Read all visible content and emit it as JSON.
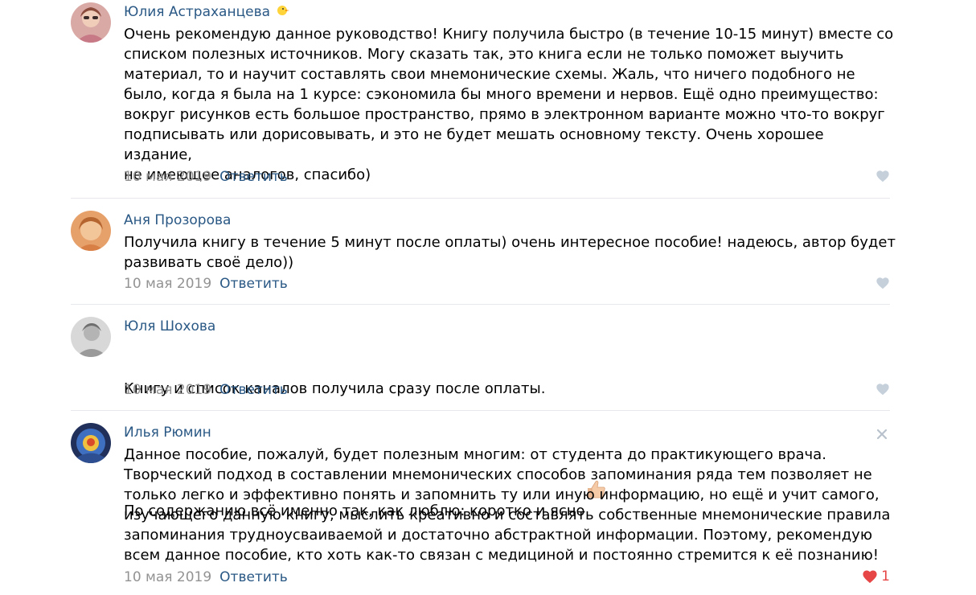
{
  "comments": [
    {
      "author": "Юлия Астраханцева",
      "author_emoji": "🐥",
      "text": "Очень рекомендую данное руководство! Книгу получила быстро (в течение 10-15 минут) вместе со\nсписком полезных источников. Могу сказать так, это книга если не только поможет выучить\nматериал, то и научит составлять свои мнемонические схемы. Жаль, что ничего подобного не\nбыло, когда я была на 1 курсе: сэкономила бы много времени и нервов. Ещё одно преимущество:\nвокруг рисунков есть большое пространство, прямо в электронном варианте можно что-то вокруг\nподписывать или дорисовывать, и это не будет мешать основному тексту. Очень хорошее издание,\nне имеющее аналогов, спасибо)",
      "date": "10 мая 2019",
      "reply_label": "Ответить"
    },
    {
      "author": "Аня Прозорова",
      "text": "Получила книгу в течение 5 минут после оплаты) очень интересное пособие! надеюсь, автор будет\nразвивать своё дело))",
      "date": "10 мая 2019",
      "reply_label": "Ответить"
    },
    {
      "author": "Юля Шохова",
      "text_line1": "Книгу и список каналов получила сразу после оплаты.",
      "text_line2": "По содержанию всё именно так, как люблю: коротко и ясно",
      "date": "10 мая 2019",
      "reply_label": "Ответить"
    },
    {
      "author": "Илья Рюмин",
      "text": "Данное пособие, пожалуй, будет полезным многим: от студента до практикующего врача.\nТворческий подход в составлении мнемонических способов запоминания ряда тем позволяет не\nтолько легко и эффективно понять и запомнить ту или иную информацию, но ещё и учит самого,\nизучающего данную книгу, мыслить креативно и составлять собственные мнемонические правила\nзапоминания трудноусваиваемой и достаточно абстрактной информации. Поэтому, рекомендую\nвсем данное пособие, кто хоть как-то связан с медициной и постоянно стремится к её познанию!",
      "date": "10 мая 2019",
      "reply_label": "Ответить",
      "like_count": "1"
    }
  ],
  "colors": {
    "author": "#2a5885",
    "date": "#939393",
    "like_inactive": "#c5d0db",
    "like_active": "#e64646",
    "divider": "#e7e8ec"
  }
}
